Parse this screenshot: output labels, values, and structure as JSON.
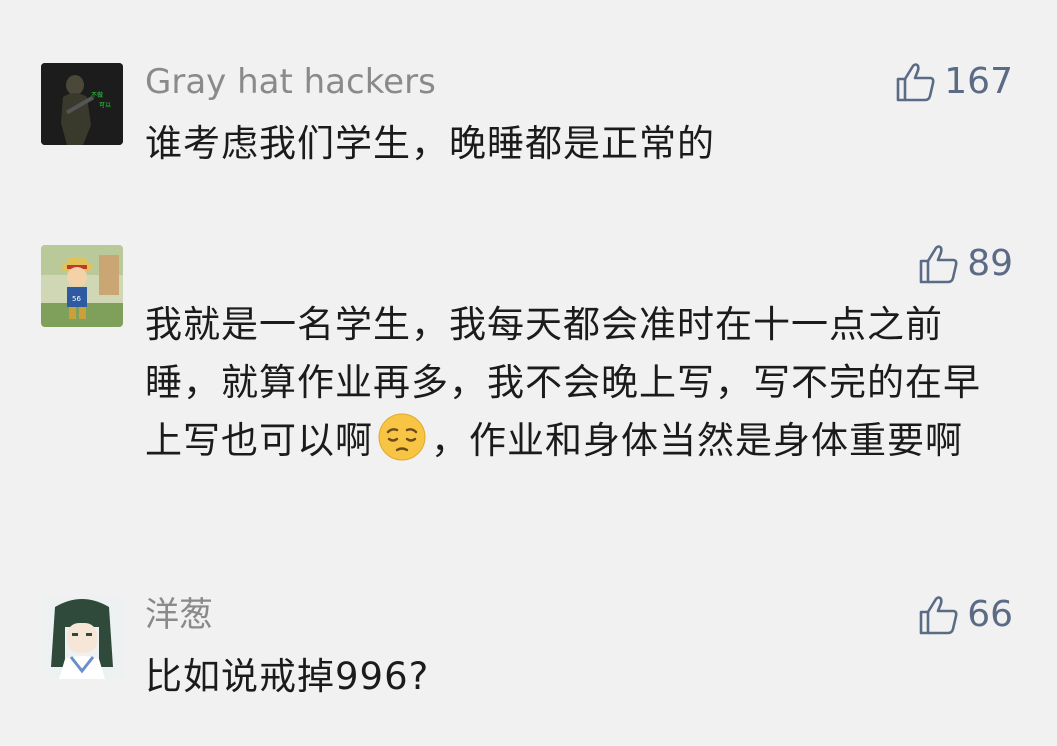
{
  "comments": [
    {
      "username": "Gray hat hackers",
      "likes": "167",
      "avatar_icon": "soldier-avatar-icon",
      "text": "谁考虑我们学生，晚睡都是正常的"
    },
    {
      "username": "",
      "likes": "89",
      "avatar_icon": "cartoon-boy-avatar-icon",
      "text_before_emoji": "我就是一名学生，我每天都会准时在十一点之前睡，就算作业再多，我不会晚上写，写不完的在早上写也可以啊",
      "emoji_icon": "pensive-face-emoji-icon",
      "text_after_emoji": "，作业和身体当然是身体重要啊"
    },
    {
      "username": "洋葱",
      "likes": "66",
      "avatar_icon": "anime-girl-avatar-icon",
      "text": "比如说戒掉996?"
    }
  ],
  "colors": {
    "background": "#f1f1f1",
    "username": "#8a8a8a",
    "like": "#5b6b86",
    "text": "#1b1b1b"
  },
  "icons": {
    "like": "thumbs-up-icon"
  }
}
